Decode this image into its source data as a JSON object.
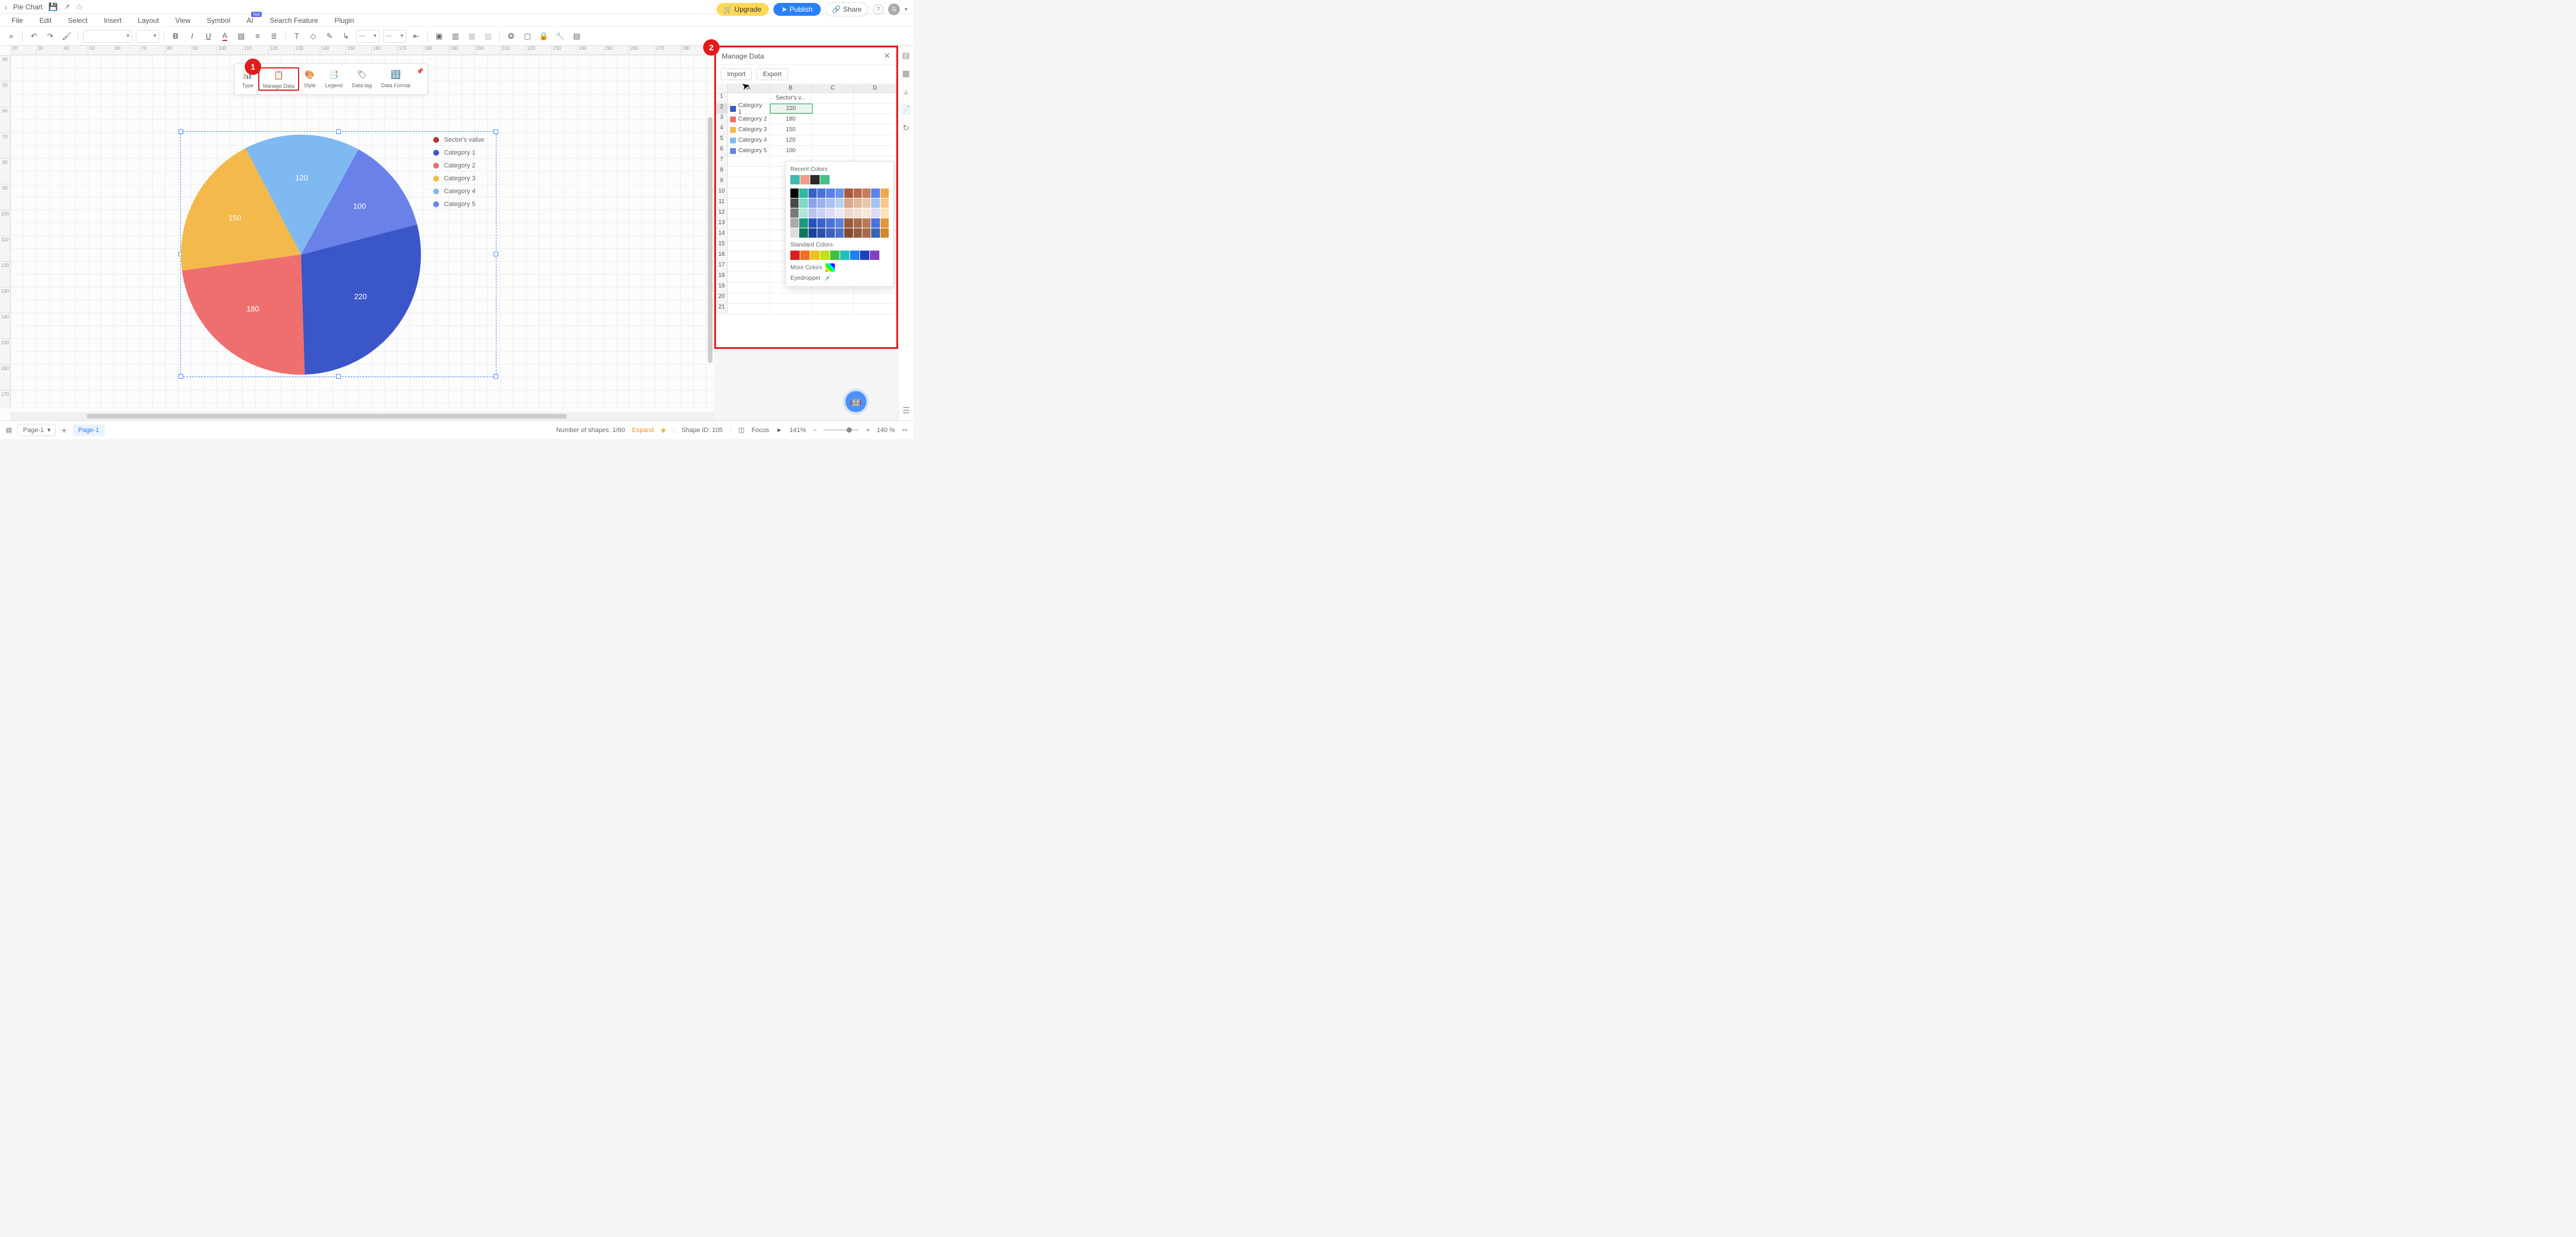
{
  "title_bar": {
    "title": "Pie Chart"
  },
  "menu": {
    "items": [
      "File",
      "Edit",
      "Select",
      "Insert",
      "Layout",
      "View",
      "Symbol",
      "AI",
      "Search Feature",
      "Plugin"
    ],
    "hot_index": 7
  },
  "header_buttons": {
    "upgrade": "Upgrade",
    "publish": "Publish",
    "share": "Share",
    "avatar_initial": "S"
  },
  "chart_toolbar": {
    "items": [
      "Type",
      "Manage Data",
      "Style",
      "Legend",
      "Data tag",
      "Data Format"
    ],
    "highlighted_index": 1,
    "marker": "1"
  },
  "ruler_h": [
    "20",
    "30",
    "40",
    "50",
    "60",
    "70",
    "80",
    "90",
    "100",
    "110",
    "120",
    "130",
    "140",
    "150",
    "160",
    "170",
    "180",
    "190",
    "200",
    "210",
    "220",
    "230",
    "240",
    "250",
    "260",
    "270",
    "280"
  ],
  "ruler_v": [
    "40",
    "50",
    "60",
    "70",
    "80",
    "90",
    "100",
    "110",
    "120",
    "130",
    "140",
    "150",
    "160",
    "170"
  ],
  "chart_data": {
    "type": "pie",
    "title": "",
    "series_label": "Sector's value",
    "categories": [
      "Category 1",
      "Category 2",
      "Category 3",
      "Category 4",
      "Category 5"
    ],
    "values": [
      220,
      180,
      150,
      120,
      100
    ],
    "colors": [
      "#3a56c8",
      "#ef6f6f",
      "#f3b94a",
      "#7eb9f2",
      "#6a82e8"
    ],
    "legend_header_color": "#b33535",
    "data_labels": [
      "220",
      "180",
      "150",
      "120",
      "100"
    ]
  },
  "manage_panel": {
    "title": "Manage Data",
    "marker": "2",
    "import": "Import",
    "export": "Export",
    "columns": [
      "A",
      "B",
      "C",
      "D"
    ],
    "header_row_span_text": "Sector's v...",
    "rows": [
      {
        "n": 1,
        "color": null,
        "label": "",
        "value": ""
      },
      {
        "n": 2,
        "color": "#3a56c8",
        "label": "Category 1",
        "value": "220",
        "active": true
      },
      {
        "n": 3,
        "color": "#ef6f6f",
        "label": "Category 2",
        "value": "180"
      },
      {
        "n": 4,
        "color": "#f3b94a",
        "label": "Category 3",
        "value": "150"
      },
      {
        "n": 5,
        "color": "#7eb9f2",
        "label": "Category 4",
        "value": "120"
      },
      {
        "n": 6,
        "color": "#6a82e8",
        "label": "Category 5",
        "value": "100"
      }
    ],
    "empty_rows": [
      7,
      8,
      9,
      10,
      11,
      12,
      13,
      14,
      15,
      16,
      17,
      18,
      19,
      20,
      21
    ]
  },
  "color_picker": {
    "recent_label": "Recent Colors",
    "recent": [
      "#3fb8af",
      "#ef9e8a",
      "#2b2b2b",
      "#47c08a"
    ],
    "theme_rows": [
      [
        "#000000",
        "#2fb8a0",
        "#3a62c8",
        "#4a72d8",
        "#5a82e8",
        "#6a92e8",
        "#a85a3a",
        "#b86a4a",
        "#c87a5a",
        "#5a82e8",
        "#f3a84a"
      ],
      [
        "#4a4a4a",
        "#7fd8c8",
        "#8aa2e8",
        "#9ab2f0",
        "#aac2f0",
        "#bad2f0",
        "#d8a88a",
        "#e0b89a",
        "#e8c8aa",
        "#aac2f0",
        "#f8c88a"
      ],
      [
        "#7a7a7a",
        "#afe8d8",
        "#bac2f0",
        "#cad2f8",
        "#dadcf8",
        "#eae8f8",
        "#f0d8c8",
        "#f4e0d0",
        "#f8e8d8",
        "#dadcf8",
        "#fce0b8"
      ],
      [
        "#aaaaaa",
        "#1a9880",
        "#2a52b8",
        "#3a62c8",
        "#4a72d8",
        "#5a82d8",
        "#985a3a",
        "#a86a4a",
        "#b87a5a",
        "#4a72d8",
        "#e0983a"
      ],
      [
        "#dddddd",
        "#0a7860",
        "#1a4298",
        "#2a52a8",
        "#3a62b8",
        "#4a72c8",
        "#884a2a",
        "#985a3a",
        "#a86a4a",
        "#3a62b8",
        "#d0882a"
      ]
    ],
    "standard_label": "Standard Colors",
    "standard": [
      "#d82020",
      "#f07020",
      "#f0c020",
      "#c0e020",
      "#40c040",
      "#20c0c0",
      "#2080f0",
      "#2040c0",
      "#8040c0"
    ],
    "more_label": "More Colors",
    "eyedropper_label": "Eyedropper"
  },
  "status": {
    "page_label": "Page-1",
    "page_tab": "Page-1",
    "shapes_text": "Number of shapes: 1/60",
    "expand": "Expand",
    "shape_id": "Shape ID: 105",
    "focus": "Focus",
    "zoom_pct": "141%",
    "zoom_display": "140 %"
  }
}
